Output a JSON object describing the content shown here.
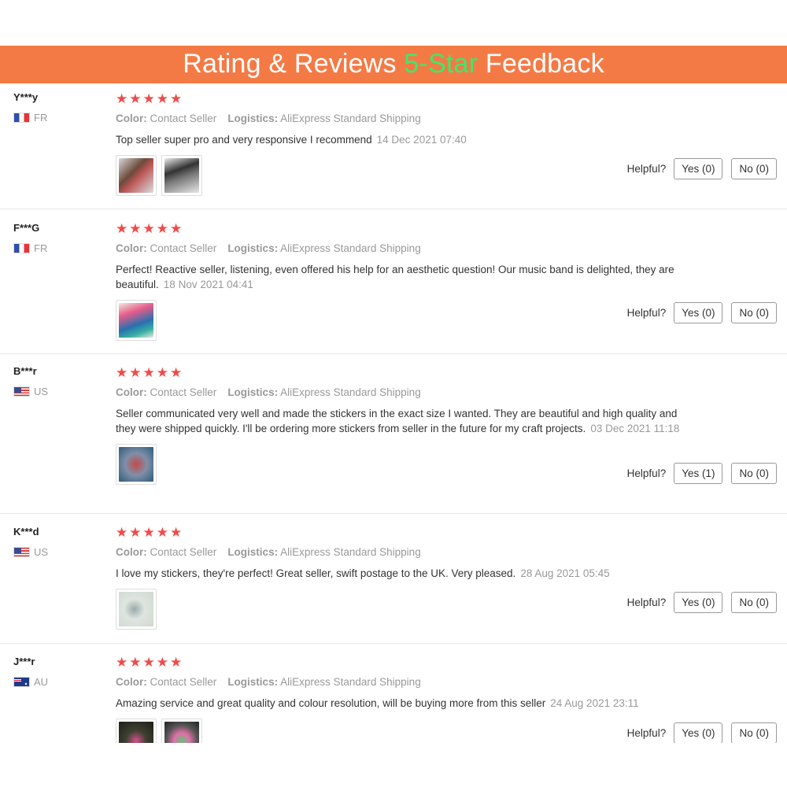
{
  "banner": {
    "part1": "Rating & Reviews ",
    "accent": "5-Star",
    "part2": " Feedback"
  },
  "labels": {
    "color": "Color:",
    "logistics": "Logistics:",
    "helpful": "Helpful?"
  },
  "colors": {
    "banner_bg": "#f47a45",
    "accent_green": "#3ee86a",
    "star_red": "#f24a4a"
  },
  "reviews": [
    {
      "user": "Y***y",
      "country": "FR",
      "stars": "★★★★★",
      "rating": 5,
      "color_value": "Contact Seller",
      "logistics_value": "AliExpress Standard Shipping",
      "text": "Top seller super pro and very responsive I recommend",
      "date": "14 Dec 2021 07:40",
      "yes": "Yes (0)",
      "no": "No (0)"
    },
    {
      "user": "F***G",
      "country": "FR",
      "stars": "★★★★★",
      "rating": 5,
      "color_value": "Contact Seller",
      "logistics_value": "AliExpress Standard Shipping",
      "text": "Perfect! Reactive seller, listening, even offered his help for an aesthetic question! Our music band is delighted, they are beautiful.",
      "date": "18 Nov 2021 04:41",
      "yes": "Yes (0)",
      "no": "No (0)"
    },
    {
      "user": "B***r",
      "country": "US",
      "stars": "★★★★★",
      "rating": 5,
      "color_value": "Contact Seller",
      "logistics_value": "AliExpress Standard Shipping",
      "text": "Seller communicated very well and made the stickers in the exact size I wanted. They are beautiful and high quality and they were shipped quickly. I'll be ordering more stickers from seller in the future for my craft projects.",
      "date": "03 Dec 2021 11:18",
      "yes": "Yes (1)",
      "no": "No (0)"
    },
    {
      "user": "K***d",
      "country": "US",
      "stars": "★★★★★",
      "rating": 5,
      "color_value": "Contact Seller",
      "logistics_value": "AliExpress Standard Shipping",
      "text": "I love my stickers, they're perfect! Great seller, swift postage to the UK. Very pleased.",
      "date": "28 Aug 2021 05:45",
      "yes": "Yes (0)",
      "no": "No (0)"
    },
    {
      "user": "J***r",
      "country": "AU",
      "stars": "★★★★★",
      "rating": 5,
      "color_value": "Contact Seller",
      "logistics_value": "AliExpress Standard Shipping",
      "text": "Amazing service and great quality and colour resolution, will be buying more from this seller",
      "date": "24 Aug 2021 23:11",
      "yes": "Yes (0)",
      "no": "No (0)"
    }
  ]
}
